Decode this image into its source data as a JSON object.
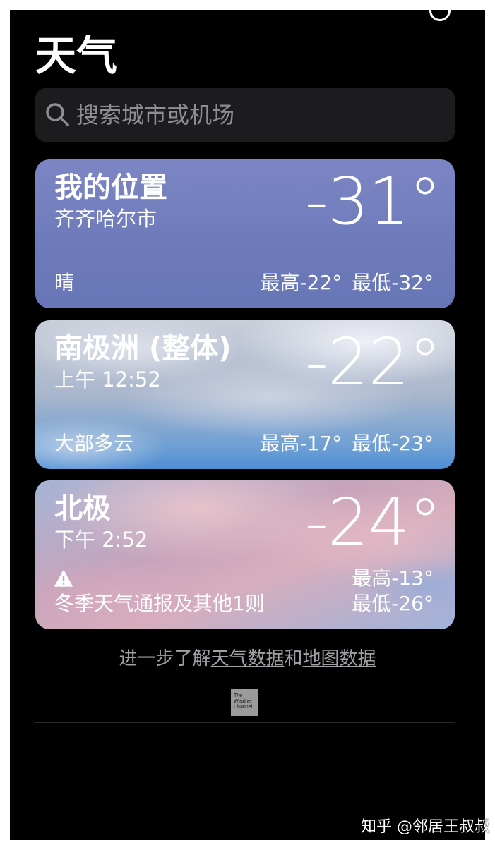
{
  "app": {
    "title": "天气"
  },
  "search": {
    "placeholder": "搜索城市或机场",
    "icon": "search-icon"
  },
  "cards": [
    {
      "title": "我的位置",
      "subtitle": "齐齐哈尔市",
      "temperature": "-31°",
      "condition": "晴",
      "high": "最高-22°",
      "low": "最低-32°"
    },
    {
      "title": "南极洲 (整体)",
      "subtitle": "上午 12:52",
      "temperature": "-22°",
      "condition": "大部多云",
      "high": "最高-17°",
      "low": "最低-23°"
    },
    {
      "title": "北极",
      "subtitle": "下午 2:52",
      "temperature": "-24°",
      "condition": "冬季天气通报及其他1则",
      "high": "最高-13°",
      "low": "最低-26°"
    }
  ],
  "footer": {
    "prefix": "进一步了解",
    "link1": "天气数据",
    "middle": "和",
    "link2": "地图数据"
  },
  "logo": {
    "line1": "The",
    "line2": "Weather",
    "line3": "Channel"
  },
  "watermark": "知乎 @邻居王叔叔",
  "colors": {
    "background": "#000000",
    "search_bg": "#1c1c1e",
    "placeholder": "#8e8e93",
    "footer_text": "#a0a0a5"
  }
}
